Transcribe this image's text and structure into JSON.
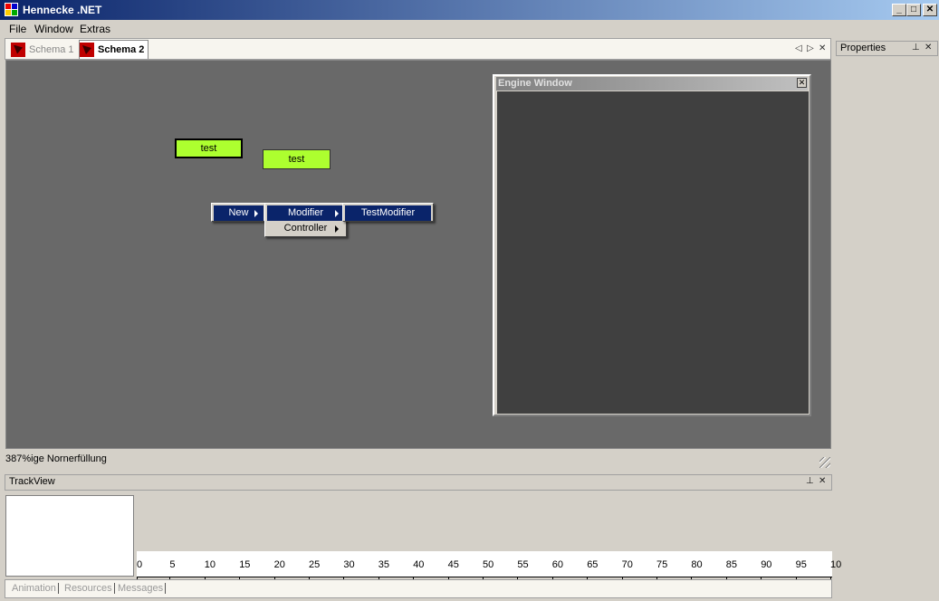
{
  "window": {
    "title": "Hennecke .NET",
    "min": "_",
    "max": "□",
    "close": "✕"
  },
  "menu": [
    "File",
    "Window",
    "Extras"
  ],
  "doc_tabs": [
    {
      "label": "Schema 1",
      "active": false
    },
    {
      "label": "Schema 2",
      "active": true
    }
  ],
  "strip_controls": {
    "prev": "◁",
    "next": "▷",
    "close": "✕"
  },
  "canvas": {
    "nodes": [
      "test",
      "test"
    ],
    "context_menu": {
      "root": "New",
      "submenu": [
        "Modifier",
        "Controller"
      ],
      "modifiers": [
        "TestModifier"
      ]
    }
  },
  "engine_window": {
    "title": "Engine Window",
    "close": "✕"
  },
  "properties": {
    "title": "Properties",
    "pin": "⊥",
    "close": "✕"
  },
  "status": {
    "text": "387%ige Nornerfüllung"
  },
  "trackview": {
    "title": "TrackView",
    "pin": "⊥",
    "close": "✕",
    "ruler": [
      "0",
      "5",
      "10",
      "15",
      "20",
      "25",
      "30",
      "35",
      "40",
      "45",
      "50",
      "55",
      "60",
      "65",
      "70",
      "75",
      "80",
      "85",
      "90",
      "95",
      "10"
    ]
  },
  "bottom_tabs": [
    "Animation",
    "Resources",
    "Messages"
  ],
  "colors": {
    "titlebar": "#0a246a",
    "node_fill": "#adff2f",
    "menu_highlight": "#0a246a",
    "canvas_bg": "#696969",
    "engine_bg": "#404040"
  }
}
